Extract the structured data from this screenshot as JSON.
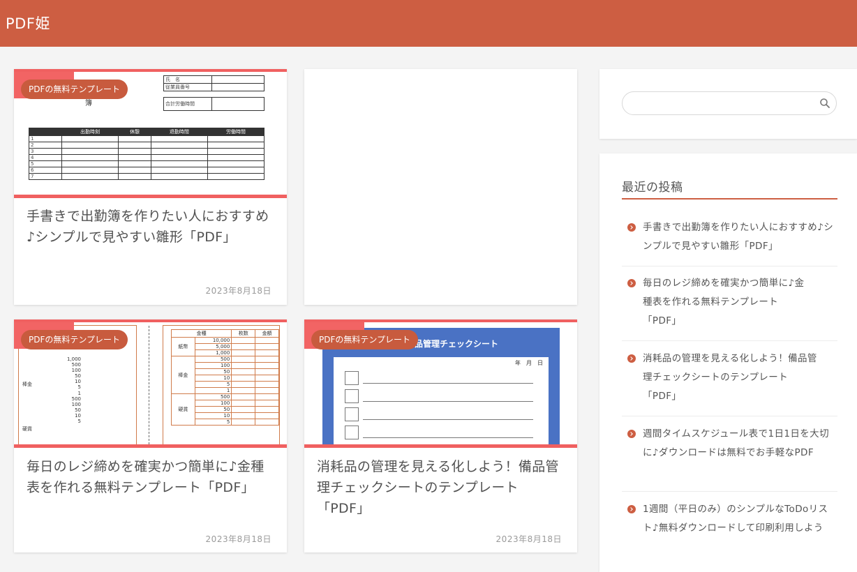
{
  "header": {
    "site_title": "PDF姫"
  },
  "cards": [
    {
      "badge": "PDFの無料テンプレート",
      "title": "手書きで出勤簿を作りたい人におすすめ♪シンプルで見やすい雛形「PDF」",
      "date": "2023年8月18日"
    },
    {
      "badge": "",
      "title": "",
      "date": ""
    },
    {
      "badge": "PDFの無料テンプレート",
      "title": "毎日のレジ締めを確実かつ簡単に♪金種表を作れる無料テンプレート「PDF」",
      "date": "2023年8月18日"
    },
    {
      "badge": "PDFの無料テンプレート",
      "title": "消耗品の管理を見える化しよう！備品管理チェックシートのテンプレート「PDF」",
      "date": "2023年8月18日"
    }
  ],
  "thumb1": {
    "name_label": "氏　名",
    "employee_no": "従業員番号",
    "total_hours": "合計労働時間",
    "heading_char": "簿",
    "cols": [
      "出勤時刻",
      "休憩",
      "退勤時間",
      "労働時間"
    ],
    "rows": [
      "1",
      "2",
      "3",
      "4",
      "5",
      "6",
      "7"
    ]
  },
  "thumb3": {
    "cols": [
      "金種",
      "枚数",
      "金額"
    ],
    "bills_label": "紙幣",
    "coins_label": "棒金",
    "hard_label": "硬貨",
    "bill_values": [
      "10,000",
      "5,000",
      "1,000"
    ],
    "coin_values": [
      "500",
      "100",
      "50",
      "10",
      "5",
      "1"
    ],
    "hard_values": [
      "500",
      "100",
      "50",
      "10",
      "5"
    ],
    "left_values": [
      "1,000",
      "500",
      "100",
      "50",
      "10",
      "5",
      "1",
      "500",
      "100",
      "50",
      "10",
      "5"
    ]
  },
  "thumb4": {
    "sheet_title": "品管理チェックシート",
    "date_labels": "年　月　日"
  },
  "sidebar": {
    "search_placeholder": "",
    "recent_heading": "最近の投稿",
    "posts": [
      "手書きで出勤簿を作りたい人におすすめ♪シンプルで見やすい雛形「PDF」",
      "毎日のレジ締めを確実かつ簡単に♪金種表を作れる無料テンプレート「PDF」",
      "消耗品の管理を見える化しよう！備品管理チェックシートのテンプレート「PDF」",
      "週間タイムスケジュール表で1日1日を大切に♪ダウンロードは無料でお手軽なPDF",
      "1週間（平日のみ）のシンプルなToDoリスト♪無料ダウンロードして印刷利用しよう"
    ]
  },
  "colors": {
    "header": "#cd5e42",
    "accent": "#f06060",
    "badge": "#c85b3e"
  }
}
